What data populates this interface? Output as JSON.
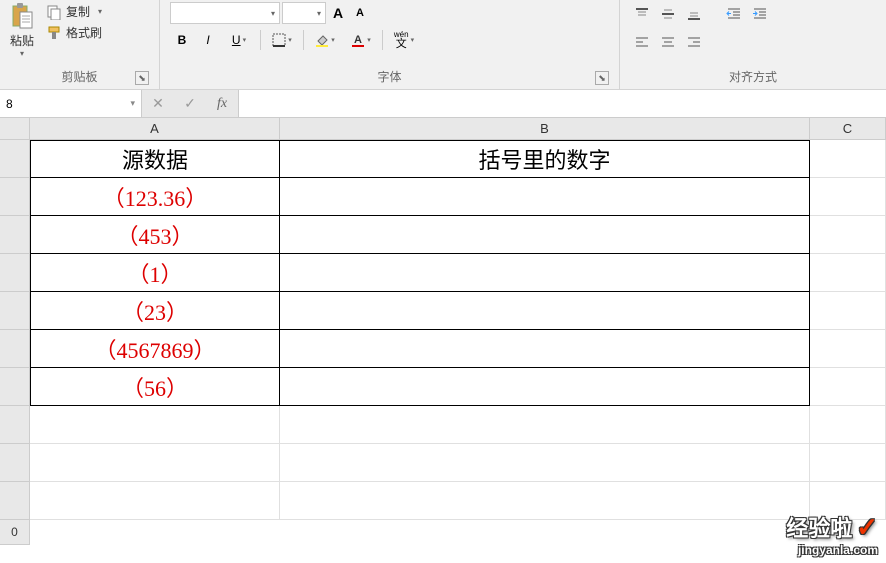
{
  "ribbon": {
    "clipboard": {
      "paste_label": "粘贴",
      "copy_label": "复制",
      "format_painter_label": "格式刷",
      "group_label": "剪贴板"
    },
    "font": {
      "bold": "B",
      "italic": "I",
      "underline": "U",
      "wen": "wén",
      "wen2": "文",
      "group_label": "字体"
    },
    "alignment": {
      "group_label": "对齐方式"
    }
  },
  "formula_bar": {
    "name_box": "8",
    "fx_label": "fx",
    "formula": ""
  },
  "columns": [
    "A",
    "B",
    "C"
  ],
  "table": {
    "headers": {
      "a": "源数据",
      "b": "括号里的数字"
    },
    "rows": [
      {
        "a": "（123.36）",
        "b": ""
      },
      {
        "a": "（453）",
        "b": ""
      },
      {
        "a": "（1）",
        "b": ""
      },
      {
        "a": "（23）",
        "b": ""
      },
      {
        "a": "（4567869）",
        "b": ""
      },
      {
        "a": "（56）",
        "b": ""
      }
    ]
  },
  "watermark": {
    "main": "经验啦",
    "sub": "jingyanla.com"
  }
}
